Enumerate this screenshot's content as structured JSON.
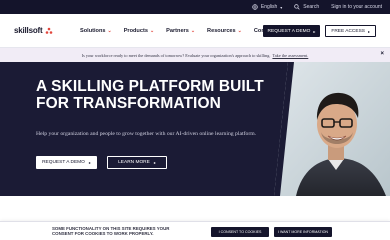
{
  "utility_bar": {
    "language": "English",
    "search": "Search",
    "signin": "Sign in to your account"
  },
  "brand": {
    "name": "skillsoft"
  },
  "nav": {
    "items": [
      {
        "label": "Solutions"
      },
      {
        "label": "Products"
      },
      {
        "label": "Partners"
      },
      {
        "label": "Resources"
      },
      {
        "label": "Company"
      }
    ],
    "request_demo": "REQUEST A DEMO",
    "free_access": "FREE ACCESS"
  },
  "banner": {
    "text": "Is your workforce ready to meet the demands of tomorrow? Evaluate your organization's approach to skilling.",
    "link": "Take the assessment."
  },
  "hero": {
    "title": "A SKILLING PLATFORM BUILT FOR TRANSFORMATION",
    "subtitle": "Help your organization and people to grow together with our AI-driven online learning platform.",
    "primary_button": "REQUEST A DEMO",
    "secondary_button": "LEARN MORE"
  },
  "cookie": {
    "text": "SOME FUNCTIONALITY ON THIS SITE REQUIRES YOUR CONSENT FOR COOKIES TO WORK PROPERLY.",
    "consent_button": "I CONSENT TO COOKIES",
    "more_info_button": "I WANT MORE INFORMATION"
  },
  "colors": {
    "dark_navy": "#14142b",
    "hero_bg": "#1b1b35",
    "accent_red": "#e2463c",
    "banner_bg": "#f1ecf6"
  }
}
